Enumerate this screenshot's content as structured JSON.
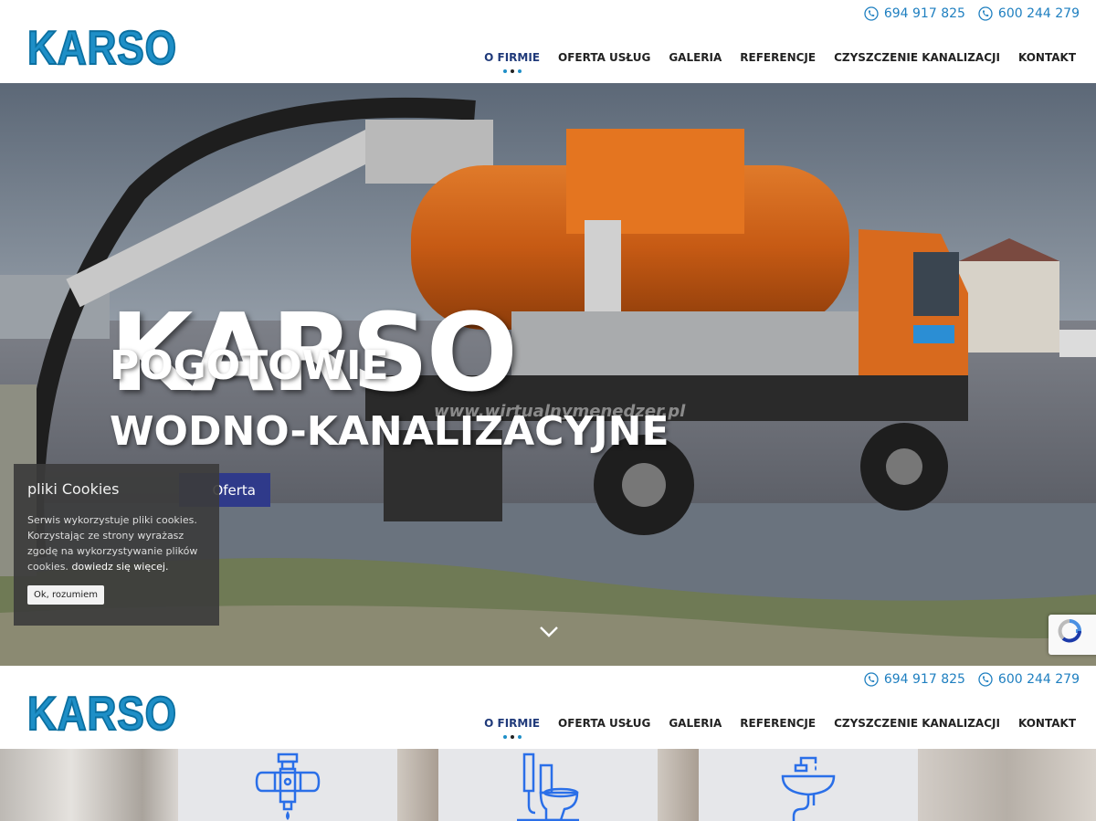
{
  "brand": {
    "logo_text": "KARSO",
    "accent": "#1e8fc7",
    "nav_active": "#203a7a",
    "button_bg": "#2f3a8a"
  },
  "header": {
    "phones": [
      "694 917 825",
      "600 244 279"
    ],
    "nav": [
      {
        "label": "O FIRMIE",
        "active": true
      },
      {
        "label": "OFERTA USŁUG",
        "active": false
      },
      {
        "label": "GALERIA",
        "active": false
      },
      {
        "label": "REFERENCJE",
        "active": false
      },
      {
        "label": "CZYSZCZENIE KANALIZACJI",
        "active": false
      },
      {
        "label": "KONTAKT",
        "active": false
      }
    ]
  },
  "hero": {
    "title": "KARSO",
    "subtitle1": "POGOTOWIE",
    "subtitle2": "WODNO-KANALIZACYJNE",
    "button_label": "Oferta",
    "watermark": "www.wirtualnymenedzer.pl"
  },
  "cookie": {
    "title": "pliki Cookies",
    "text": "Serwis wykorzystuje pliki cookies. Korzystając ze strony wyrażasz zgodę na wykorzystywanie plików cookies.",
    "link": "dowiedz się więcej.",
    "button": "Ok, rozumiem"
  },
  "icons": {
    "phone": "phone-icon",
    "scroll": "chevron-down-icon",
    "tiles": [
      "pipe-valve-icon",
      "toilet-icon",
      "sink-icon"
    ]
  }
}
